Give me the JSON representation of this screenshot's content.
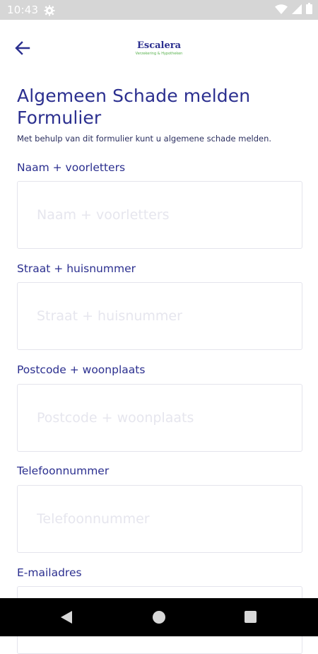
{
  "status_bar": {
    "time": "10:43",
    "icons": [
      "settings-gear-icon",
      "wifi-icon",
      "signal-icon",
      "battery-icon"
    ]
  },
  "header": {
    "back_icon": "arrow-left-icon",
    "logo_name": "Escalera",
    "logo_tagline": "Verzekering & Hypotheken"
  },
  "page": {
    "title_line1": "Algemeen Schade melden",
    "title_line2": "Formulier",
    "subtitle": "Met behulp van dit formulier kunt u algemene schade melden."
  },
  "form": {
    "fields": [
      {
        "label": "Naam + voorletters",
        "placeholder": "Naam + voorletters"
      },
      {
        "label": "Straat + huisnummer",
        "placeholder": "Straat + huisnummer"
      },
      {
        "label": "Postcode + woonplaats",
        "placeholder": "Postcode + woonplaats"
      },
      {
        "label": "Telefoonnummer",
        "placeholder": "Telefoonnummer"
      },
      {
        "label": "E-mailadres",
        "placeholder": ""
      }
    ]
  },
  "colors": {
    "accent": "#2b2f8f",
    "logo_green": "#55b04a",
    "status_bar": "#d6d6d6",
    "nav_bar": "#000000"
  }
}
